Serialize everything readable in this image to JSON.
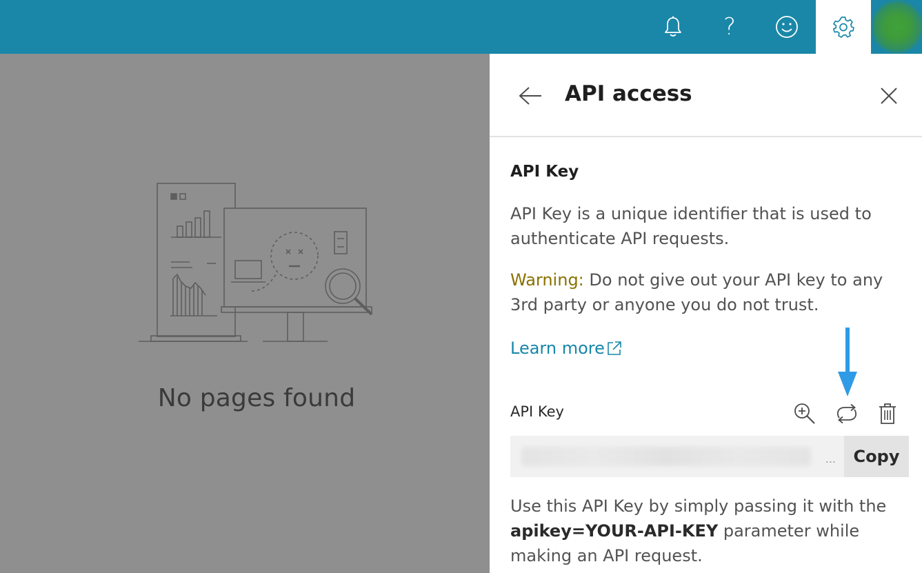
{
  "topbar": {
    "icons": {
      "notifications": "bell-icon",
      "help": "help-icon",
      "help_glyph": "?",
      "feedback": "smiley-icon",
      "settings": "gear-icon",
      "avatar": "avatar"
    },
    "colors": {
      "bar": "#1a87a8",
      "active_tab": "#ffffff"
    }
  },
  "main": {
    "empty_state_title": "No pages found",
    "overlay_color": "#8f8f8f"
  },
  "panel": {
    "title": "API access",
    "back_icon": "arrow-left-icon",
    "close_icon": "close-icon",
    "section_title": "API Key",
    "description": "API Key is a unique identifier that is used to authenticate API requests.",
    "warning_label": "Warning:",
    "warning_text": " Do not give out your API key to any 3rd party or anyone you do not trust.",
    "learn_more": "Learn more",
    "key_label": "API Key",
    "key_actions": [
      "zoom-in-icon",
      "regenerate-icon",
      "delete-icon"
    ],
    "key_value_truncation": "...",
    "copy_label": "Copy",
    "usage_prefix": "Use this API Key by simply passing it with the ",
    "usage_param": "apikey=YOUR-API-KEY",
    "usage_suffix": " parameter while making an API request.",
    "colors": {
      "warning": "#8a7100",
      "link": "#1686a8",
      "highlight_arrow": "#2f9be6"
    }
  }
}
